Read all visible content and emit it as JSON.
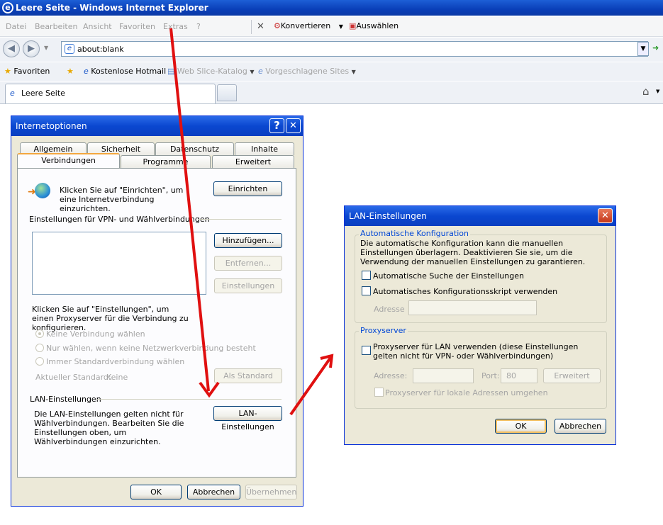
{
  "browser": {
    "title": "Leere Seite - Windows Internet Explorer",
    "menu": [
      "Datei",
      "Bearbeiten",
      "Ansicht",
      "Favoriten",
      "Extras",
      "?"
    ],
    "toolbar": {
      "convert_label": "Konvertieren",
      "select_label": "Auswählen"
    },
    "address": "about:blank",
    "favorites": {
      "label": "Favoriten",
      "items": [
        "Kostenlose Hotmail",
        "Web Slice-Katalog",
        "Vorgeschlagene Sites"
      ]
    },
    "tab_label": "Leere Seite"
  },
  "internet_options": {
    "title": "Internetoptionen",
    "help": "?",
    "tabs_back": [
      "Allgemein",
      "Sicherheit",
      "Datenschutz",
      "Inhalte"
    ],
    "tabs_front": [
      "Verbindungen",
      "Programme",
      "Erweitert"
    ],
    "setup_text": "Klicken Sie auf \"Einrichten\", um eine Internetverbindung einzurichten.",
    "setup_button": "Einrichten",
    "vpn_heading": "Einstellungen für VPN- und Wählverbindungen",
    "vpn_buttons": [
      "Hinzufügen...",
      "Entfernen...",
      "Einstellungen"
    ],
    "proxy_text": "Klicken Sie auf \"Einstellungen\", um einen Proxyserver für die Verbindung zu konfigurieren.",
    "radios": [
      "Keine Verbindung wählen",
      "Nur wählen, wenn keine Netzwerkverbindung besteht",
      "Immer Standardverbindung wählen"
    ],
    "default_label": "Aktueller Standard:",
    "default_value": "Keine",
    "default_button": "Als Standard",
    "lan_heading": "LAN-Einstellungen",
    "lan_text": "Die LAN-Einstellungen gelten nicht für Wählverbindungen. Bearbeiten Sie die Einstellungen oben, um Wählverbindungen einzurichten.",
    "lan_button": "LAN-Einstellungen",
    "ok": "OK",
    "cancel": "Abbrechen",
    "apply": "Übernehmen"
  },
  "lan_settings": {
    "title": "LAN-Einstellungen",
    "auto_group": "Automatische Konfiguration",
    "auto_text": "Die automatische Konfiguration kann die manuellen Einstellungen überlagern. Deaktivieren Sie sie, um die Verwendung der manuellen Einstellungen zu garantieren.",
    "auto_detect": "Automatische Suche der Einstellungen",
    "auto_script": "Automatisches Konfigurationsskript verwenden",
    "address_label": "Adresse",
    "proxy_group": "Proxyserver",
    "proxy_use": "Proxyserver für LAN verwenden (diese Einstellungen gelten nicht für VPN- oder Wählverbindungen)",
    "proxy_address_label": "Adresse:",
    "port_label": "Port:",
    "port_value": "80",
    "advanced_button": "Erweitert",
    "bypass_local": "Proxyserver für lokale Adressen umgehen",
    "ok": "OK",
    "cancel": "Abbrechen"
  }
}
